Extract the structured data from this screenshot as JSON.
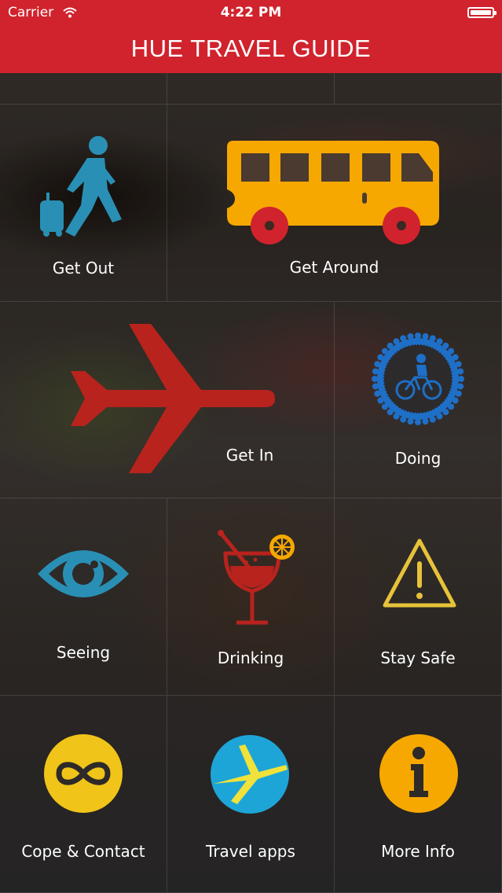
{
  "status_bar": {
    "carrier": "Carrier",
    "time": "4:22 PM"
  },
  "header": {
    "title": "HUE TRAVEL GUIDE"
  },
  "tiles": [
    {
      "label": "Get Out",
      "icon": "traveler-luggage-icon"
    },
    {
      "label": "Get Around",
      "icon": "bus-icon"
    },
    {
      "label": "Get In",
      "icon": "airplane-icon"
    },
    {
      "label": "Doing",
      "icon": "bicycle-badge-icon"
    },
    {
      "label": "Seeing",
      "icon": "eye-icon"
    },
    {
      "label": "Drinking",
      "icon": "cocktail-icon"
    },
    {
      "label": "Stay Safe",
      "icon": "warning-triangle-icon"
    },
    {
      "label": "Cope & Contact",
      "icon": "infinity-icon"
    },
    {
      "label": "Travel apps",
      "icon": "travel-plane-circle-icon"
    },
    {
      "label": "More Info",
      "icon": "info-icon"
    }
  ],
  "colors": {
    "header": "#d0232d",
    "bus": "#f6a800",
    "bus_wheels": "#d0232d",
    "airplane": "#b8231d",
    "doing": "#1e6fc7",
    "seeing": "#2a8fb4",
    "drinking": "#b8231d",
    "stay_safe": "#e7c23a",
    "cope": "#f0c419",
    "travel_apps": "#1ea5d8",
    "more_info": "#f6a800"
  }
}
